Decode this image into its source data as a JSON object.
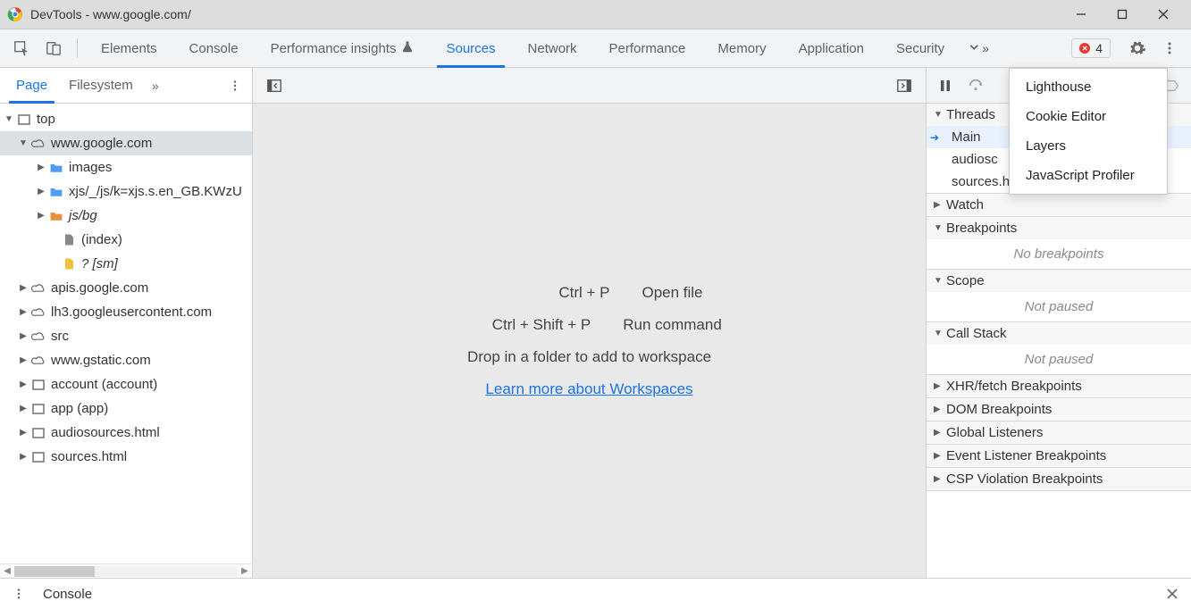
{
  "window": {
    "title": "DevTools - www.google.com/"
  },
  "panel_tabs": {
    "elements": "Elements",
    "console": "Console",
    "performance_insights": "Performance insights",
    "sources": "Sources",
    "network": "Network",
    "performance": "Performance",
    "memory": "Memory",
    "application": "Application",
    "security": "Security"
  },
  "overflow_menu": {
    "lighthouse": "Lighthouse",
    "cookie_editor": "Cookie Editor",
    "layers": "Layers",
    "js_profiler": "JavaScript Profiler"
  },
  "errors": {
    "count": "4"
  },
  "left": {
    "page": "Page",
    "filesystem": "Filesystem",
    "tree": {
      "top": "top",
      "google": "www.google.com",
      "images": "images",
      "xjs": "xjs/_/js/k=xjs.s.en_GB.KWzU",
      "jsbg": "js/bg",
      "index": "(index)",
      "sm": "? [sm]",
      "apis": "apis.google.com",
      "lh3": "lh3.googleusercontent.com",
      "src": "src",
      "gstatic": "www.gstatic.com",
      "account": "account (account)",
      "app": "app (app)",
      "audio": "audiosources.html",
      "sourceshtml": "sources.html"
    }
  },
  "center": {
    "open_file_key": "Ctrl + P",
    "open_file": "Open file",
    "run_cmd_key": "Ctrl + Shift + P",
    "run_cmd": "Run command",
    "drop": "Drop in a folder to add to workspace",
    "learn": "Learn more about Workspaces"
  },
  "right": {
    "threads": "Threads",
    "main": "Main",
    "audio_sc": "audiosc",
    "sourceshtml": "sources.html",
    "watch": "Watch",
    "breakpoints": "Breakpoints",
    "no_breakpoints": "No breakpoints",
    "scope": "Scope",
    "not_paused": "Not paused",
    "callstack": "Call Stack",
    "xhr": "XHR/fetch Breakpoints",
    "dom": "DOM Breakpoints",
    "global": "Global Listeners",
    "event": "Event Listener Breakpoints",
    "csp": "CSP Violation Breakpoints"
  },
  "drawer": {
    "console": "Console"
  }
}
